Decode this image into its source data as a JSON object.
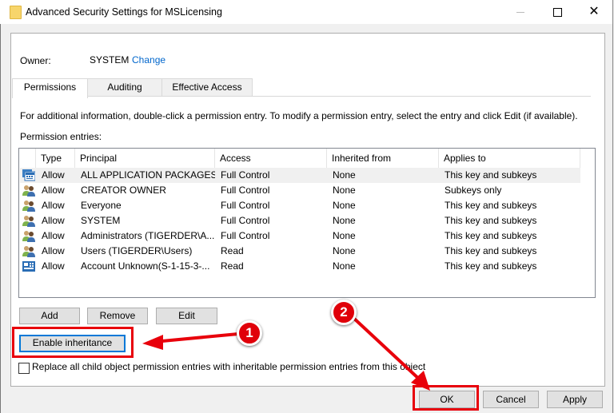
{
  "window": {
    "title": "Advanced Security Settings for MSLicensing",
    "icon": "folder-icon",
    "controls": [
      "minimize-icon",
      "maximize-icon",
      "close-icon"
    ],
    "close_glyph": "✕"
  },
  "owner": {
    "label": "Owner:",
    "value": "SYSTEM",
    "change_link": "Change"
  },
  "tabs": [
    {
      "label": "Permissions",
      "active": true
    },
    {
      "label": "Auditing",
      "active": false
    },
    {
      "label": "Effective Access",
      "active": false
    }
  ],
  "info_text": "For additional information, double-click a permission entry. To modify a permission entry, select the entry and click Edit (if available).",
  "entries_label": "Permission entries:",
  "table": {
    "columns": [
      "Type",
      "Principal",
      "Access",
      "Inherited from",
      "Applies to"
    ],
    "rows": [
      {
        "icon": "app-packages-icon",
        "type": "Allow",
        "principal": "ALL APPLICATION PACKAGES",
        "access": "Full Control",
        "inherited": "None",
        "applies": "This key and subkeys",
        "selected": true
      },
      {
        "icon": "users-group-icon",
        "type": "Allow",
        "principal": "CREATOR OWNER",
        "access": "Full Control",
        "inherited": "None",
        "applies": "Subkeys only"
      },
      {
        "icon": "users-group-icon",
        "type": "Allow",
        "principal": "Everyone",
        "access": "Full Control",
        "inherited": "None",
        "applies": "This key and subkeys"
      },
      {
        "icon": "users-group-icon",
        "type": "Allow",
        "principal": "SYSTEM",
        "access": "Full Control",
        "inherited": "None",
        "applies": "This key and subkeys"
      },
      {
        "icon": "users-group-icon",
        "type": "Allow",
        "principal": "Administrators (TIGERDER\\A...",
        "access": "Full Control",
        "inherited": "None",
        "applies": "This key and subkeys"
      },
      {
        "icon": "users-group-icon",
        "type": "Allow",
        "principal": "Users (TIGERDER\\Users)",
        "access": "Read",
        "inherited": "None",
        "applies": "This key and subkeys"
      },
      {
        "icon": "capability-icon",
        "type": "Allow",
        "principal": "Account Unknown(S-1-15-3-...",
        "access": "Read",
        "inherited": "None",
        "applies": "This key and subkeys"
      }
    ]
  },
  "buttons": {
    "add": "Add",
    "remove": "Remove",
    "edit": "Edit",
    "enable_inheritance": "Enable inheritance",
    "ok": "OK",
    "cancel": "Cancel",
    "apply": "Apply"
  },
  "checkbox": {
    "label": "Replace all child object permission entries with inheritable permission entries from this object",
    "checked": false
  },
  "annotations": {
    "badge_1": "1",
    "badge_2": "2",
    "color": "#e8000b"
  }
}
